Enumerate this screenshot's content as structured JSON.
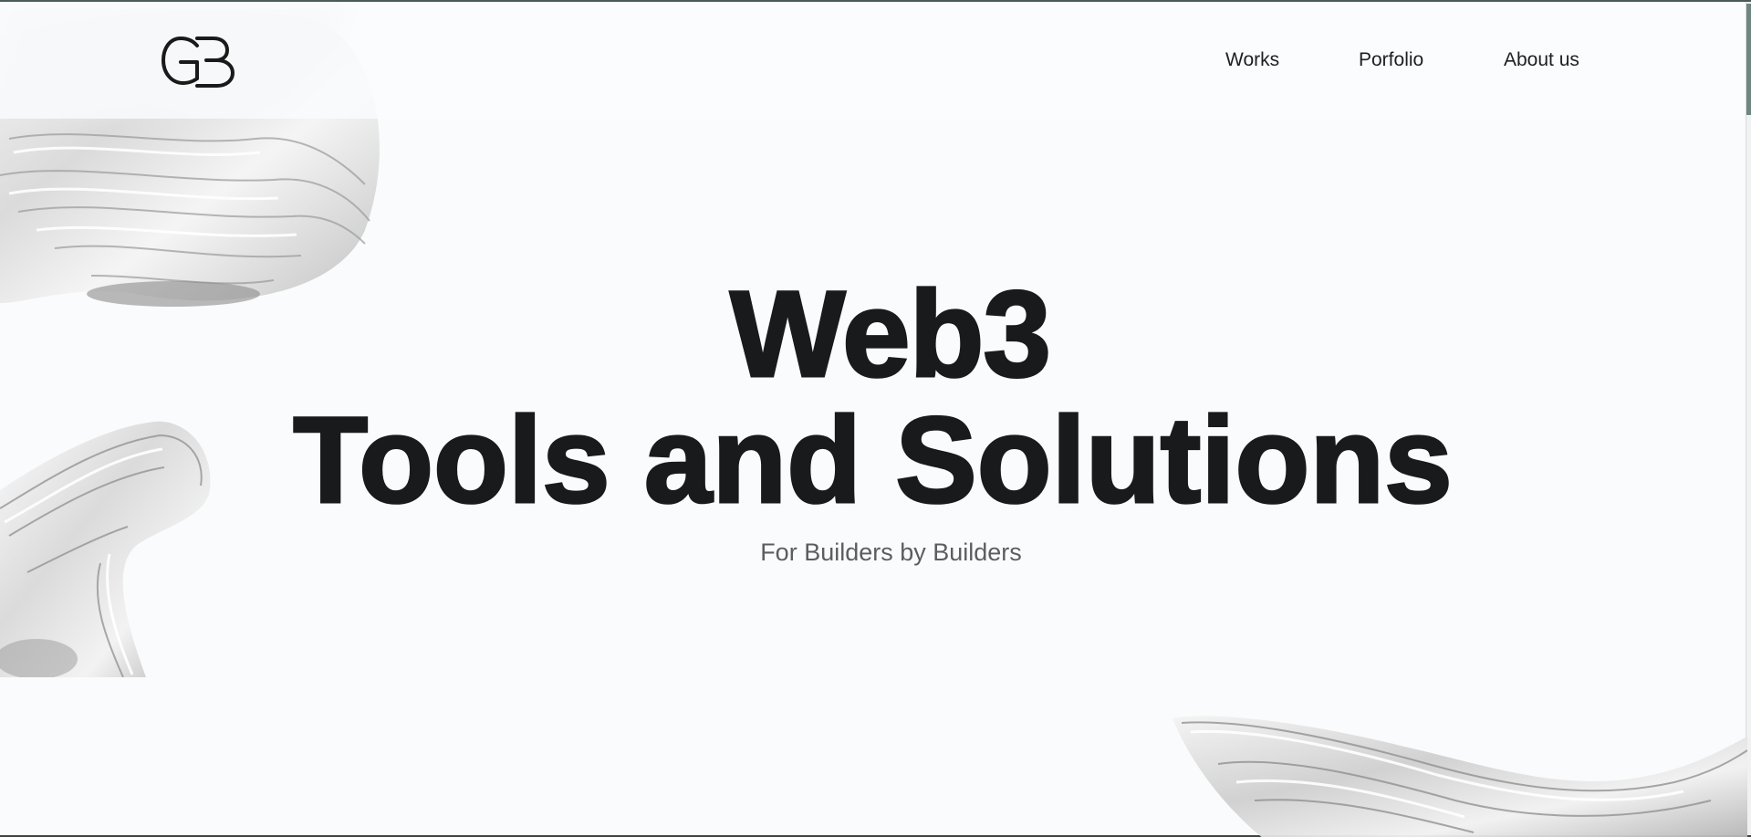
{
  "header": {
    "logo_text": "GB",
    "nav": [
      {
        "label": "Works"
      },
      {
        "label": "Porfolio"
      },
      {
        "label": "About us"
      }
    ]
  },
  "hero": {
    "title_line1": "Web3",
    "title_line2": "Tools and Solutions",
    "subtitle": "For Builders by Builders"
  },
  "colors": {
    "background": "#fafbfc",
    "title": "#191a1c",
    "subtitle": "#5b5d60",
    "nav_text": "#1d1f21",
    "scroll_thumb": "#6f8580"
  }
}
